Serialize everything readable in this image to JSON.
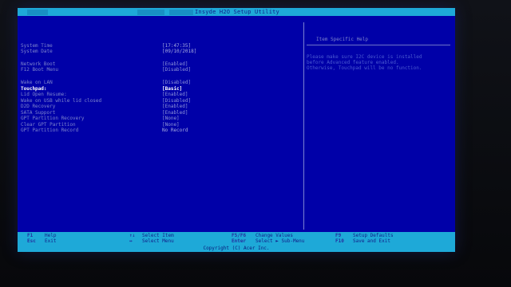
{
  "header": {
    "title": "Insyde H2O Setup Utility"
  },
  "settings": [
    {
      "label": "System Time",
      "value": "[17:47:35]"
    },
    {
      "label": "System Date",
      "value": "[09/10/2018]"
    },
    {
      "label": "Network Boot",
      "value": "[Enabled]"
    },
    {
      "label": "F12 Boot Menu",
      "value": "[Disabled]"
    },
    {
      "label": "Wake on LAN",
      "value": "[Disabled]"
    },
    {
      "label": "Touchpad:",
      "value": "[Basic]"
    },
    {
      "label": "Lid Open Resume:",
      "value": "[Enabled]"
    },
    {
      "label": "Wake on USB while lid closed",
      "value": "[Disabled]"
    },
    {
      "label": "D2D Recovery",
      "value": "[Enabled]"
    },
    {
      "label": "SATA Support",
      "value": "[Enabled]"
    },
    {
      "label": "GPT Partition Recovery",
      "value": "[None]"
    },
    {
      "label": "Clear GPT Partition",
      "value": "[None]"
    },
    {
      "label": "GPT Partition Record",
      "value": "No Record"
    }
  ],
  "help": {
    "title": "Item Specific Help",
    "lines": [
      "Please make sure I2C device is installed",
      "before Advanced feature enabled.",
      "Otherwise, Touchpad will be no function."
    ]
  },
  "footer": {
    "items": [
      {
        "key": "F1",
        "desc": "Help"
      },
      {
        "key": "Esc",
        "desc": "Exit"
      },
      {
        "key": "↑↓",
        "desc": "Select Item"
      },
      {
        "key": "↔",
        "desc": "Select Menu"
      },
      {
        "key": "F5/F6",
        "desc": "Change Values"
      },
      {
        "key": "Enter",
        "desc": "Select ► Sub-Menu"
      },
      {
        "key": "F9",
        "desc": "Setup Defaults"
      },
      {
        "key": "F10",
        "desc": "Save and Exit"
      }
    ],
    "copyright": "Copyright (C) Acer Inc."
  },
  "colors": {
    "background": "#0000a8",
    "bar": "#1ea9d8",
    "highlight": "#ffffff",
    "text": "#7d84cc"
  }
}
